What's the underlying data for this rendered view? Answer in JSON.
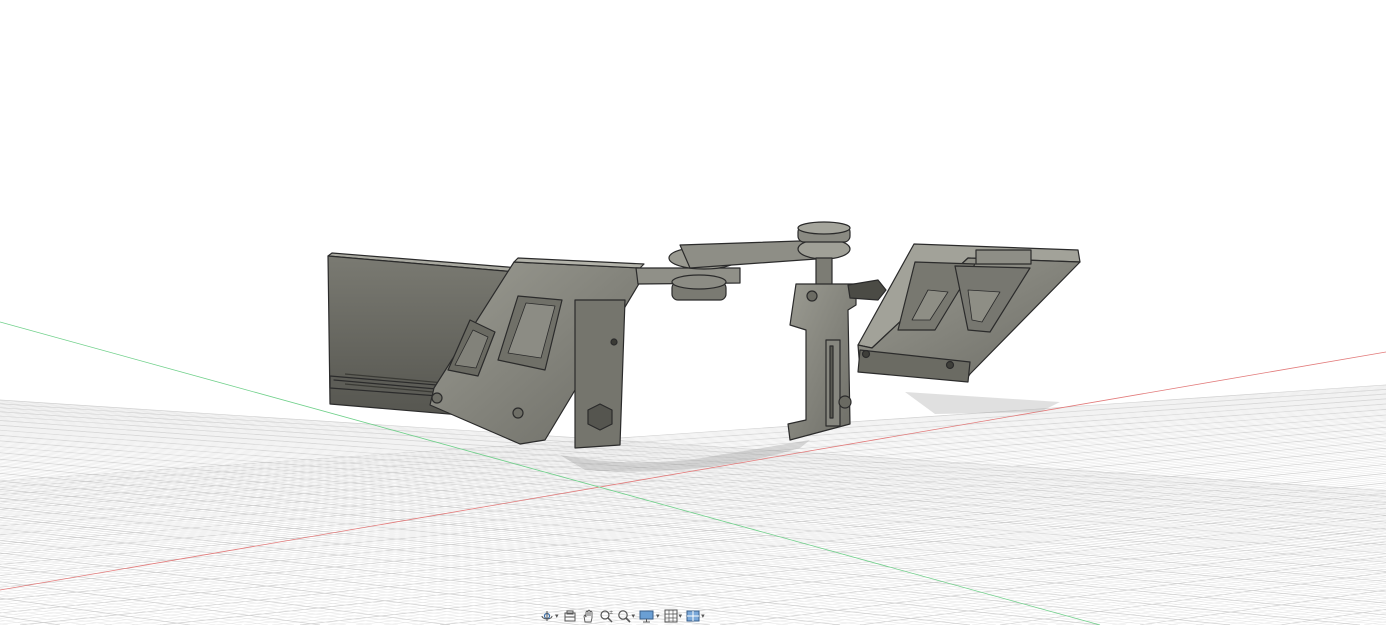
{
  "viewport": {
    "name": "3d-design-canvas",
    "grid_visible": true,
    "colors": {
      "background": "#ffffff",
      "grid_minor": "#e6e6e6",
      "grid_major": "#cfcfcf",
      "x_axis": "#e05555",
      "y_axis": "#4fc76a",
      "part_body": "#8a8a80",
      "part_edge": "#2b2b2b"
    }
  },
  "navigation_bar": {
    "tools": [
      {
        "icon": "orbit-icon",
        "has_dropdown": true
      },
      {
        "icon": "look-at-icon",
        "has_dropdown": false
      },
      {
        "icon": "pan-hand-icon",
        "has_dropdown": false
      },
      {
        "icon": "zoom-icon",
        "has_dropdown": false
      },
      {
        "icon": "fit-zoom-icon",
        "has_dropdown": true
      },
      {
        "icon": "display-settings-icon",
        "has_dropdown": true
      },
      {
        "icon": "grid-settings-icon",
        "has_dropdown": true
      },
      {
        "icon": "viewports-icon",
        "has_dropdown": true
      }
    ]
  }
}
